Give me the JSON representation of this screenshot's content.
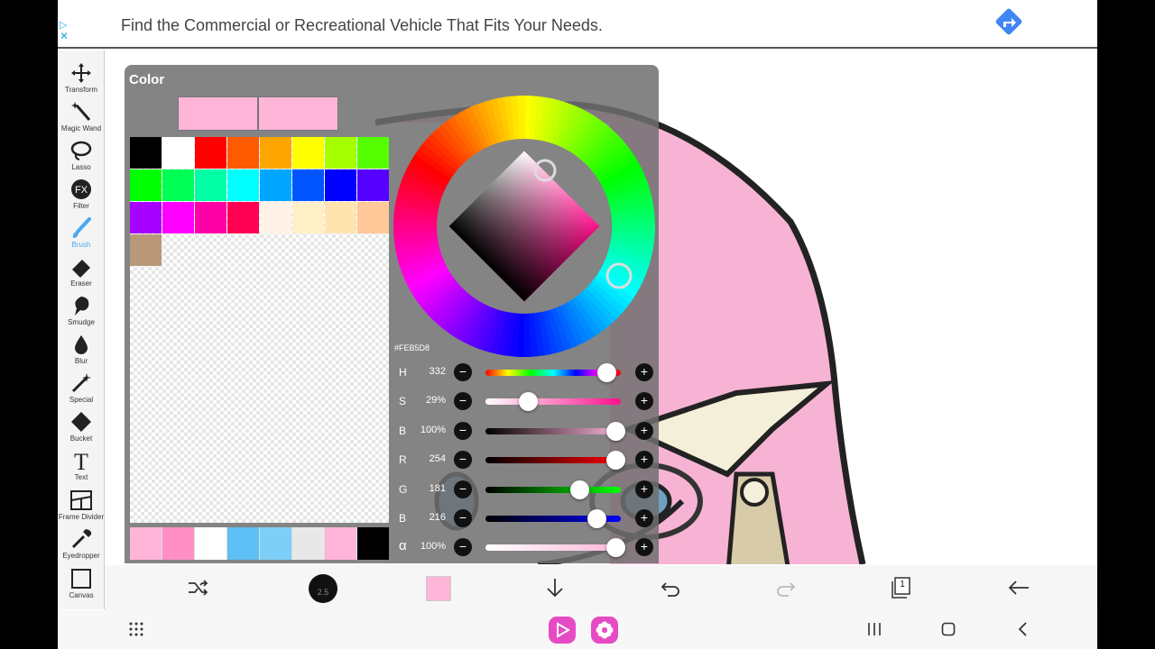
{
  "ad": {
    "text": "Find the Commercial or Recreational Vehicle That Fits Your Needs.",
    "adchoices_icon": "adchoices-icon",
    "close_icon": "close-icon",
    "action_icon": "directions-icon"
  },
  "toolbar": {
    "tools": [
      {
        "label": "Transform",
        "icon": "transform-icon"
      },
      {
        "label": "Magic Wand",
        "icon": "magic-wand-icon"
      },
      {
        "label": "Lasso",
        "icon": "lasso-icon"
      },
      {
        "label": "Filter",
        "icon": "fx-icon",
        "glyph": "FX"
      },
      {
        "label": "Brush",
        "icon": "brush-icon",
        "active": true
      },
      {
        "label": "Eraser",
        "icon": "eraser-icon"
      },
      {
        "label": "Smudge",
        "icon": "smudge-icon"
      },
      {
        "label": "Blur",
        "icon": "blur-icon"
      },
      {
        "label": "Special",
        "icon": "special-icon"
      },
      {
        "label": "Bucket",
        "icon": "bucket-icon"
      },
      {
        "label": "Text",
        "icon": "text-icon",
        "glyph": "T"
      },
      {
        "label": "Frame Divider",
        "icon": "frame-divider-icon"
      },
      {
        "label": "Eyedropper",
        "icon": "eyedropper-icon"
      },
      {
        "label": "Canvas",
        "icon": "canvas-icon"
      }
    ]
  },
  "color_panel": {
    "title": "Color",
    "current_color": "#FEB5D8",
    "previous_color": "#FEB5D8",
    "hex_label": "#FEB5D8",
    "palette": [
      "#000000",
      "#ffffff",
      "#ff0000",
      "#ff5a00",
      "#ffa500",
      "#ffff00",
      "#a6ff00",
      "#55ff00",
      "#00ff00",
      "#00ff55",
      "#00ffa6",
      "#00ffff",
      "#00a6ff",
      "#0055ff",
      "#0000ff",
      "#5500ff",
      "#a600ff",
      "#ff00ff",
      "#ff00a6",
      "#ff0055",
      "#fff3e8",
      "#fff0c8",
      "#ffe4b0",
      "#ffc898",
      "#b89878"
    ],
    "recent_colors": [
      "#ffb5d8",
      "#ff8fc4",
      "#ffffff",
      "#5ec0f4",
      "#7ecff8",
      "#e8e8e8",
      "#ffb5d8",
      "#000000"
    ],
    "sliders": [
      {
        "label": "H",
        "value": "332",
        "fraction": 0.89,
        "gradient": "linear-gradient(90deg,#ff0000,#ffff00,#00ff00,#00ffff,#0000ff,#ff00ff,#ff0000)"
      },
      {
        "label": "S",
        "value": "29%",
        "fraction": 0.31,
        "gradient": "linear-gradient(90deg,#ffffff,#ff0f8c)"
      },
      {
        "label": "B",
        "value": "100%",
        "fraction": 0.96,
        "gradient": "linear-gradient(90deg,#000000,#feb5d8)"
      },
      {
        "label": "R",
        "value": "254",
        "fraction": 0.96,
        "gradient": "linear-gradient(90deg,#000000,#ff0000)"
      },
      {
        "label": "G",
        "value": "181",
        "fraction": 0.69,
        "gradient": "linear-gradient(90deg,#000000,#00ff00)"
      },
      {
        "label": "B",
        "value": "216",
        "fraction": 0.82,
        "gradient": "linear-gradient(90deg,#000000,#0000ff)"
      },
      {
        "label": "α",
        "value": "100%",
        "fraction": 0.96,
        "gradient": "linear-gradient(90deg,#ffffff,#feb5d8)"
      }
    ],
    "minus_glyph": "−",
    "plus_glyph": "+"
  },
  "appbar": {
    "brush_size": "2.5",
    "color": "#FEB5D8",
    "icons": [
      "shuffle-icon",
      "brush-size-icon",
      "color-swatch-icon",
      "download-icon",
      "undo-icon",
      "redo-icon",
      "layers-icon",
      "back-arrow-icon"
    ],
    "layers_count": "1"
  },
  "navbar": {
    "icons": [
      "apps-grid-icon",
      "app-shortcut-icon",
      "flower-app-icon",
      "recents-icon",
      "home-icon",
      "back-icon"
    ]
  }
}
